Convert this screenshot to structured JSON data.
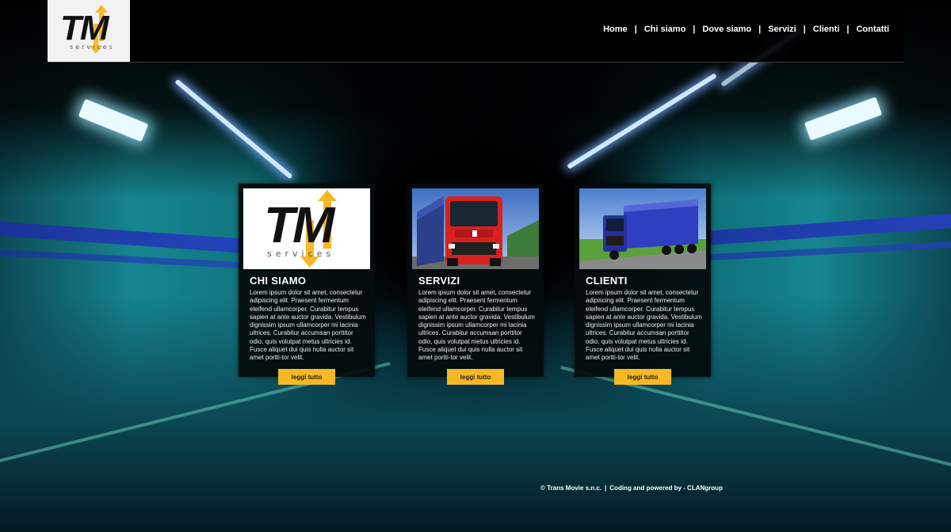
{
  "logo": {
    "letters": "TM",
    "sub": "services"
  },
  "nav": {
    "items": [
      "Home",
      "Chi siamo",
      "Dove siamo",
      "Servizi",
      "Clienti",
      "Contatti"
    ],
    "separator": "|"
  },
  "cards": [
    {
      "title": "CHI SIAMO",
      "body": "Lorem ipsum dolor sit amet, consectetur adipiscing elit. Praesent fermentum eleifend ullamcorper. Curabitur tempus sapien at ante auctor gravida. Vestibulum dignissim ipsum ullamcorper mi lacinia ultrices. Curabitur accumsan porttitor odio, quis volutpat metus ultricies id. Fusce aliquet dui quis nulla auctor sit amet portti-tor velit.",
      "button": "leggi tutto"
    },
    {
      "title": "SERVIZI",
      "body": "Lorem ipsum dolor sit amet, consectetur adipiscing elit. Praesent fermentum eleifend ullamcorper. Curabitur tempus sapien at ante auctor gravida. Vestibulum dignissim ipsum ullamcorper mi lacinia ultrices. Curabitur accumsan porttitor odio, quis volutpat metus ultricies id. Fusce aliquet dui quis nulla auctor sit amet portti-tor velit.",
      "button": "leggi tutto"
    },
    {
      "title": "CLIENTI",
      "body": "Lorem ipsum dolor sit amet, consectetur adipiscing elit. Praesent fermentum eleifend ullamcorper. Curabitur tempus sapien at ante auctor gravida. Vestibulum dignissim ipsum ullamcorper mi lacinia ultrices. Curabitur accumsan porttitor odio, quis volutpat metus ultricies id. Fusce aliquet dui quis nulla auctor sit amet portti-tor velit.",
      "button": "leggi tutto"
    }
  ],
  "footer": {
    "copyright": "© Trans Movie s.n.c.",
    "separator": "|",
    "credit": "Coding and powered by - CLANgroup"
  },
  "colors": {
    "accent": "#f6b825",
    "header_bg": "#000000",
    "logo_bg": "#f2f2f2",
    "truck_red": "#d8211f",
    "truck_blue": "#2a35b8"
  }
}
